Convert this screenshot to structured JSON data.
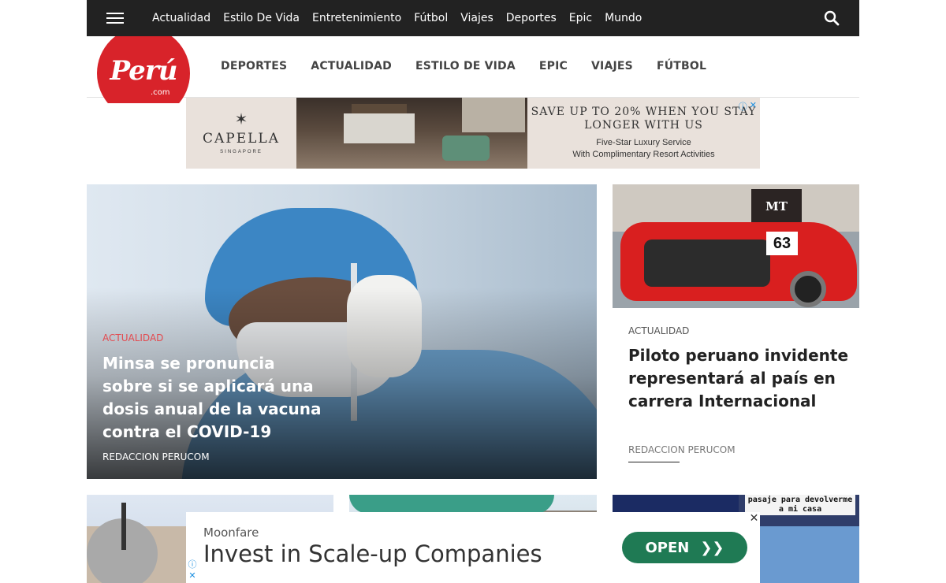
{
  "topbar": {
    "nav": [
      "Actualidad",
      "Estilo De Vida",
      "Entretenimiento",
      "Fútbol",
      "Viajes",
      "Deportes",
      "Epic",
      "Mundo"
    ],
    "search_icon": "search-icon",
    "menu_icon": "hamburger-icon"
  },
  "header": {
    "logo_text": "Perú",
    "logo_sub": ".com",
    "nav": [
      "DEPORTES",
      "ACTUALIDAD",
      "ESTILO DE VIDA",
      "EPIC",
      "VIAJES",
      "FÚTBOL"
    ],
    "brand_color": "#d8232a"
  },
  "ad_top": {
    "brand": "CAPELLA",
    "brand_sub": "SINGAPORE",
    "headline": "SAVE UP TO 20% WHEN YOU STAY LONGER WITH US",
    "line1": "Five-Star Luxury Service",
    "line2": "With Complimentary Resort Activities"
  },
  "hero": {
    "category": "ACTUALIDAD",
    "title": "Minsa se pronuncia sobre si se aplicará una dosis anual de la vacuna contra el COVID-19",
    "author": "REDACCION PERUCOM"
  },
  "side_card": {
    "category": "ACTUALIDAD",
    "title": "Piloto peruano invidente representará al país en carrera Internacional",
    "author": "REDACCION PERUCOM",
    "image_sign": "MT",
    "image_number": "63"
  },
  "thumbs": {
    "third_note": "pasaje para devolverme a mi casa"
  },
  "ad_bottom": {
    "advertiser": "Moonfare",
    "headline": "Invest in Scale-up Companies",
    "cta": "OPEN"
  }
}
